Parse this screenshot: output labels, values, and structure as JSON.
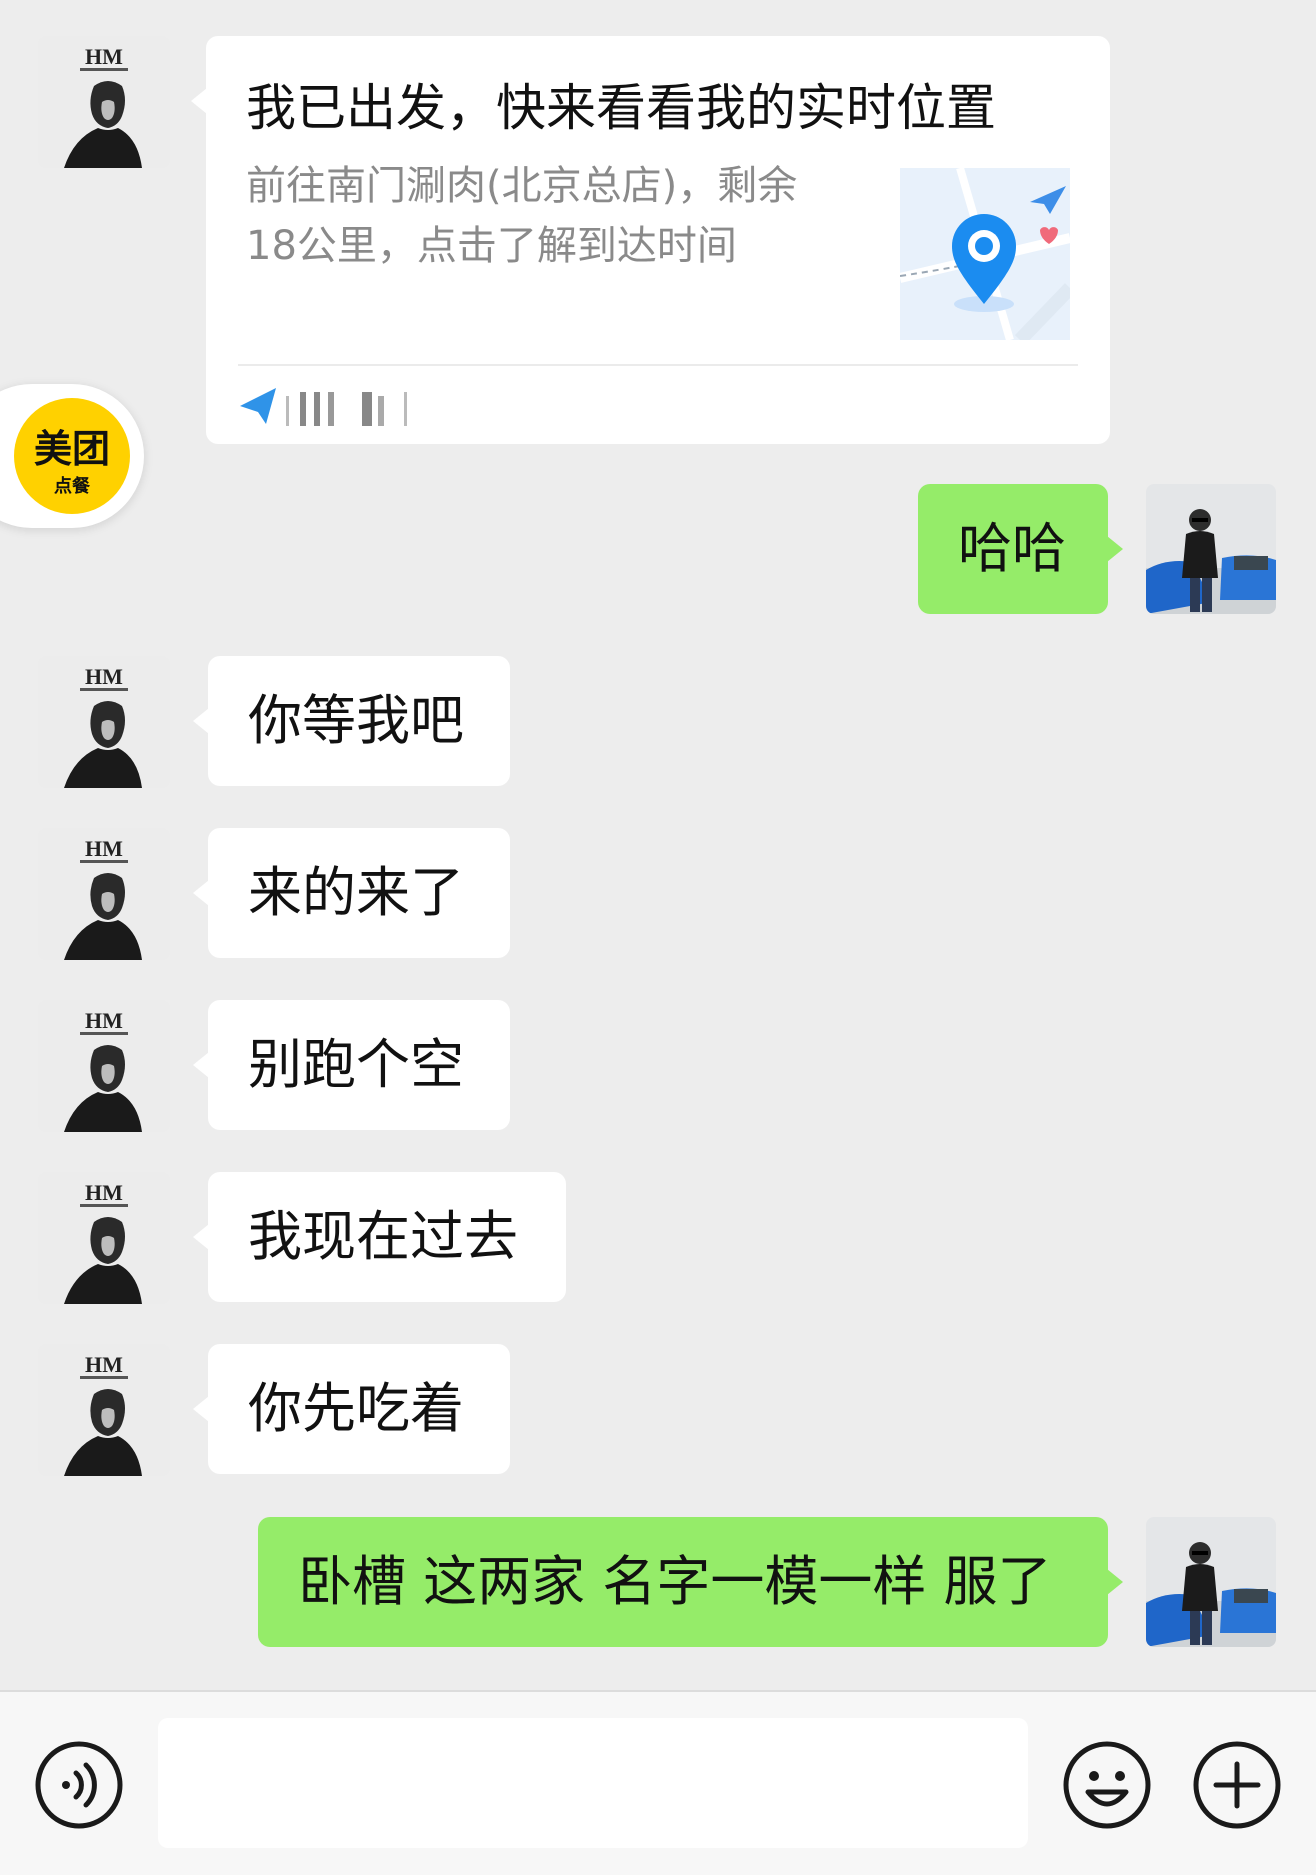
{
  "location_card": {
    "title": "我已出发，快来看看我的实时位置",
    "description": "前往南门涮肉(北京总店)，剩余18公里，点击了解到达时间"
  },
  "floating_badge": {
    "brand": "美团",
    "sub": "点餐",
    "color": "#ffd100"
  },
  "messages": [
    {
      "side": "right",
      "text": "哈哈"
    },
    {
      "side": "left",
      "text": "你等我吧"
    },
    {
      "side": "left",
      "text": "来的来了"
    },
    {
      "side": "left",
      "text": "别跑个空"
    },
    {
      "side": "left",
      "text": "我现在过去"
    },
    {
      "side": "left",
      "text": "你先吃着"
    },
    {
      "side": "right",
      "text": "卧槽 这两家 名字一模一样 服了"
    }
  ],
  "contact_avatar": {
    "logo": "HM"
  },
  "input": {
    "placeholder": ""
  },
  "icons": {
    "voice": "voice-icon",
    "emoji": "emoji-icon",
    "more": "plus-icon"
  },
  "colors": {
    "background": "#ededed",
    "sent_bubble": "#95ec69",
    "received_bubble": "#ffffff",
    "map_pin": "#1b8cf0"
  }
}
